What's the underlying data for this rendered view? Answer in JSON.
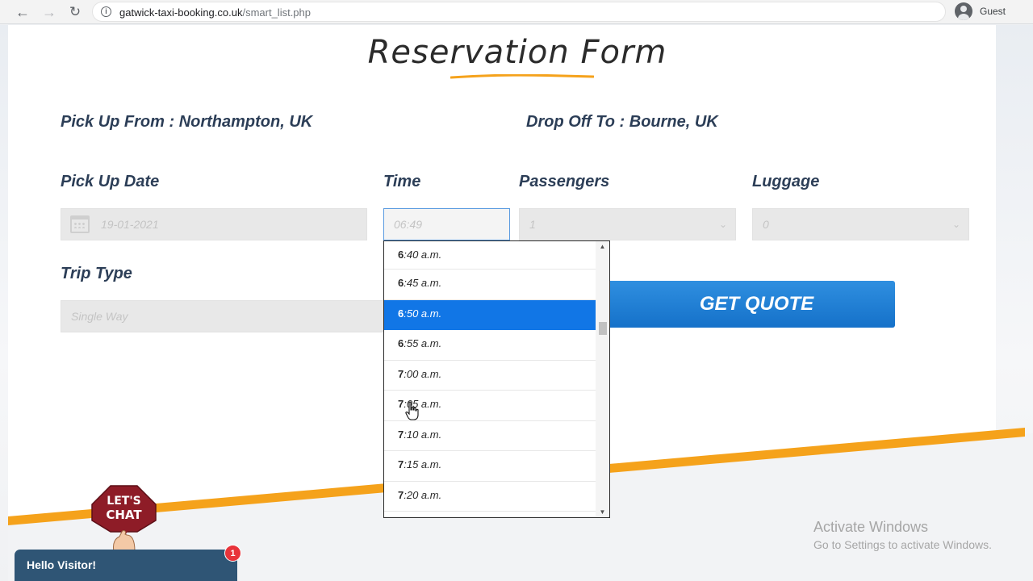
{
  "browser": {
    "url_domain": "gatwick-taxi-booking.co.uk",
    "url_path": "/smart_list.php",
    "profile_name": "Guest"
  },
  "form": {
    "title": "Reservation Form",
    "pickup": "Pick Up From : Northampton, UK",
    "dropoff": "Drop Off To : Bourne, UK",
    "labels": {
      "date": "Pick Up Date",
      "time": "Time",
      "passengers": "Passengers",
      "luggage": "Luggage",
      "trip_type": "Trip Type"
    },
    "values": {
      "date": "19-01-2021",
      "time": "06:49",
      "passengers": "1",
      "luggage": "0",
      "trip_type": "Single Way"
    },
    "quote_button": "GET QUOTE"
  },
  "time_dropdown": {
    "items": [
      {
        "hour": "6",
        "rest": ":40 a.m."
      },
      {
        "hour": "6",
        "rest": ":45 a.m."
      },
      {
        "hour": "6",
        "rest": ":50 a.m."
      },
      {
        "hour": "6",
        "rest": ":55 a.m."
      },
      {
        "hour": "7",
        "rest": ":00 a.m."
      },
      {
        "hour": "7",
        "rest": ":05 a.m."
      },
      {
        "hour": "7",
        "rest": ":10 a.m."
      },
      {
        "hour": "7",
        "rest": ":15 a.m."
      },
      {
        "hour": "7",
        "rest": ":20 a.m."
      }
    ],
    "selected_index": 2
  },
  "chat": {
    "badge_line1": "LET'S",
    "badge_line2": "CHAT",
    "greeting": "Hello Visitor!",
    "unread_count": "1"
  },
  "watermark": {
    "title": "Activate Windows",
    "subtitle": "Go to Settings to activate Windows."
  },
  "colors": {
    "accent_blue": "#1571c9",
    "selected_blue": "#1176e6",
    "orange": "#f5a21b",
    "label_navy": "#2c3e57",
    "chat_bar": "#2f5575",
    "badge_maroon": "#8e1c27"
  }
}
